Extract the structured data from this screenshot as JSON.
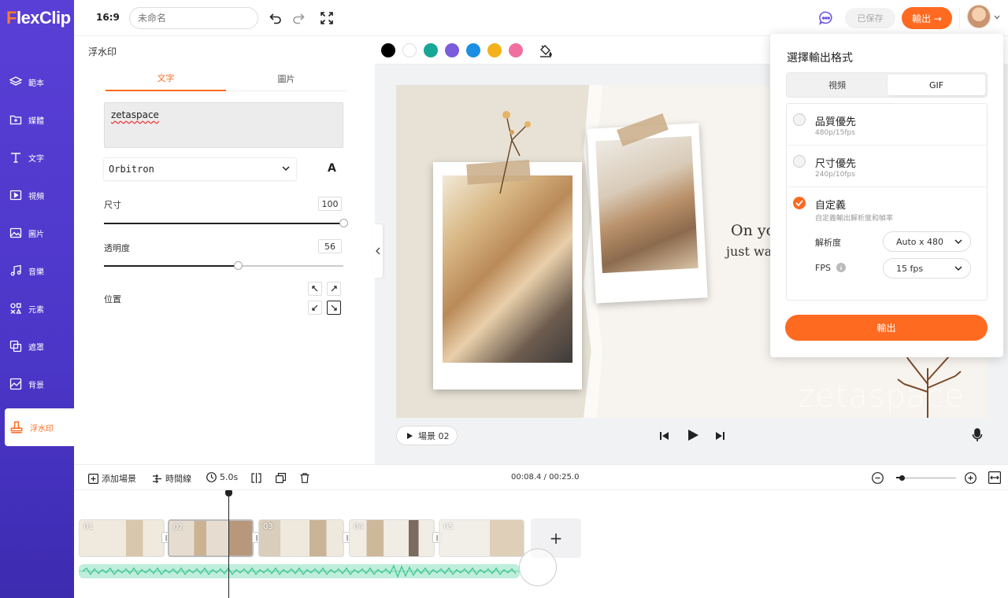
{
  "app": {
    "logo_prefix": "F",
    "logo_rest": "lexClip",
    "brand_color": "#ff6a21",
    "sidebar_color": "#5a3fd6"
  },
  "sidebar": {
    "items": [
      {
        "label": "範本",
        "icon": "layers-icon"
      },
      {
        "label": "媒體",
        "icon": "media-folder-icon"
      },
      {
        "label": "文字",
        "icon": "text-icon"
      },
      {
        "label": "視頻",
        "icon": "video-icon"
      },
      {
        "label": "圖片",
        "icon": "image-icon"
      },
      {
        "label": "音樂",
        "icon": "music-icon"
      },
      {
        "label": "元素",
        "icon": "elements-icon"
      },
      {
        "label": "遮罩",
        "icon": "overlay-icon"
      },
      {
        "label": "背景",
        "icon": "background-icon"
      },
      {
        "label": "浮水印",
        "icon": "stamp-icon",
        "active": true
      }
    ]
  },
  "topbar": {
    "ratio": "16:9",
    "title_placeholder": "未命名",
    "saved_label": "已保存",
    "export_label": "輸出 →"
  },
  "panel": {
    "title": "浮水印",
    "tabs": [
      "文字",
      "圖片"
    ],
    "text_value": "zetaspace",
    "font": "Orbitron",
    "font_color_glyph": "A",
    "size_label": "尺寸",
    "size_value": "100",
    "size_fraction": 1.0,
    "opacity_label": "透明度",
    "opacity_value": "56",
    "opacity_fraction": 0.56,
    "position_label": "位置"
  },
  "colors": [
    "#000000",
    "#ffffff",
    "#17a796",
    "#7b5cdc",
    "#1a8fe3",
    "#f3b11b",
    "#f06fa0"
  ],
  "canvas": {
    "text_line1": "On yo",
    "text_line2": "just wa",
    "watermark": "zetaspace"
  },
  "player": {
    "scene_label": "場景 02"
  },
  "export_popup": {
    "title": "選擇輸出格式",
    "formats": [
      "視頻",
      "GIF"
    ],
    "selected_format": "GIF",
    "options": [
      {
        "title": "品質優先",
        "sub": "480p/15fps",
        "checked": false
      },
      {
        "title": "尺寸優先",
        "sub": "240p/10fps",
        "checked": false
      },
      {
        "title": "自定義",
        "sub": "自定義輸出解析度和幀率",
        "checked": true
      }
    ],
    "resolution_label": "解析度",
    "resolution_value": "Auto x 480",
    "fps_label": "FPS",
    "fps_value": "15 fps",
    "export_button": "輸出"
  },
  "timeline": {
    "add_scene_label": "添加場景",
    "timeline_label": "時間線",
    "duration": "5.0s",
    "timecode": "00:08.4 / 00:25.0",
    "clips": [
      "01",
      "02",
      "03",
      "04",
      "05"
    ],
    "add_glyph": "+"
  }
}
